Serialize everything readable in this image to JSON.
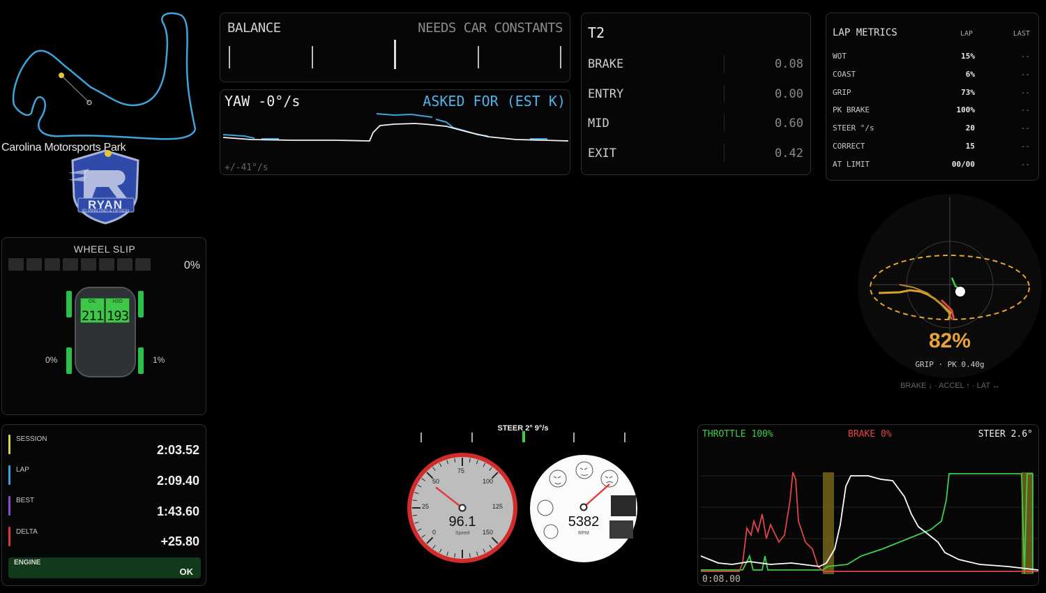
{
  "track": {
    "name": "Carolina Motorsports Park",
    "logo_text": "RYAN",
    "logo_subtext": "3D PRINTING & DESIGN"
  },
  "balance": {
    "title": "BALANCE",
    "status": "NEEDS CAR CONSTANTS"
  },
  "yaw": {
    "title": "YAW -0°/s",
    "asked": "ASKED FOR (EST K)",
    "range": "+/-41°/s"
  },
  "corner": {
    "title": "T2",
    "rows": [
      {
        "label": "BRAKE",
        "value": "0.08"
      },
      {
        "label": "ENTRY",
        "value": "0.00"
      },
      {
        "label": "MID",
        "value": "0.60"
      },
      {
        "label": "EXIT",
        "value": "0.42"
      }
    ]
  },
  "lap_metrics": {
    "title": "LAP METRICS",
    "col_lap": "LAP",
    "col_last": "LAST",
    "rows": [
      {
        "name": "WOT",
        "lap": "15%",
        "last": "--"
      },
      {
        "name": "COAST",
        "lap": "6%",
        "last": "--"
      },
      {
        "name": "GRIP",
        "lap": "73%",
        "last": "--"
      },
      {
        "name": "PK BRAKE",
        "lap": "100%",
        "last": "--"
      },
      {
        "name": "STEER °/s",
        "lap": "20",
        "last": "--"
      },
      {
        "name": "CORRECT",
        "lap": "15",
        "last": "--"
      },
      {
        "name": "AT LIMIT",
        "lap": "00/00",
        "last": "--"
      }
    ]
  },
  "wheel_slip": {
    "title": "WHEEL SLIP",
    "percent": "0%",
    "left_rear": "0%",
    "right_rear": "1%",
    "oil_label": "OIL",
    "h2o_label": "H2O",
    "oil_temp": "211",
    "h2o_temp": "193"
  },
  "grip": {
    "percent": "82%",
    "sub": "GRIP · PK 0.40g",
    "legend": "BRAKE ↓ · ACCEL ↑ · LAT ↔"
  },
  "timing": {
    "rows": [
      {
        "label": "SESSION",
        "value": "2:03.52",
        "color": "#d8d84a"
      },
      {
        "label": "LAP",
        "value": "2:09.40",
        "color": "#3aa0e0"
      },
      {
        "label": "BEST",
        "value": "1:43.60",
        "color": "#8a4ad8"
      },
      {
        "label": "DELTA",
        "value": "+25.80",
        "color": "#d83a3a"
      }
    ],
    "engine_label": "ENGINE",
    "engine_status": "OK"
  },
  "gauges": {
    "steer": "STEER 2° 9°/s",
    "speed_value": "96.1",
    "speed_label": "Speed",
    "speed_ticks": [
      "0",
      "25",
      "50",
      "75",
      "100",
      "125",
      "150"
    ],
    "speed_fraction": 0.64,
    "rpm_value": "5382",
    "rpm_label": "RPM"
  },
  "trace": {
    "throttle": "THROTTLE 100%",
    "brake": "BRAKE 0%",
    "steer": "STEER 2.6°",
    "time": "0:08.00",
    "colors": {
      "throttle": "#3ccf4a",
      "brake": "#e24545",
      "steer": "#ffffff"
    }
  }
}
